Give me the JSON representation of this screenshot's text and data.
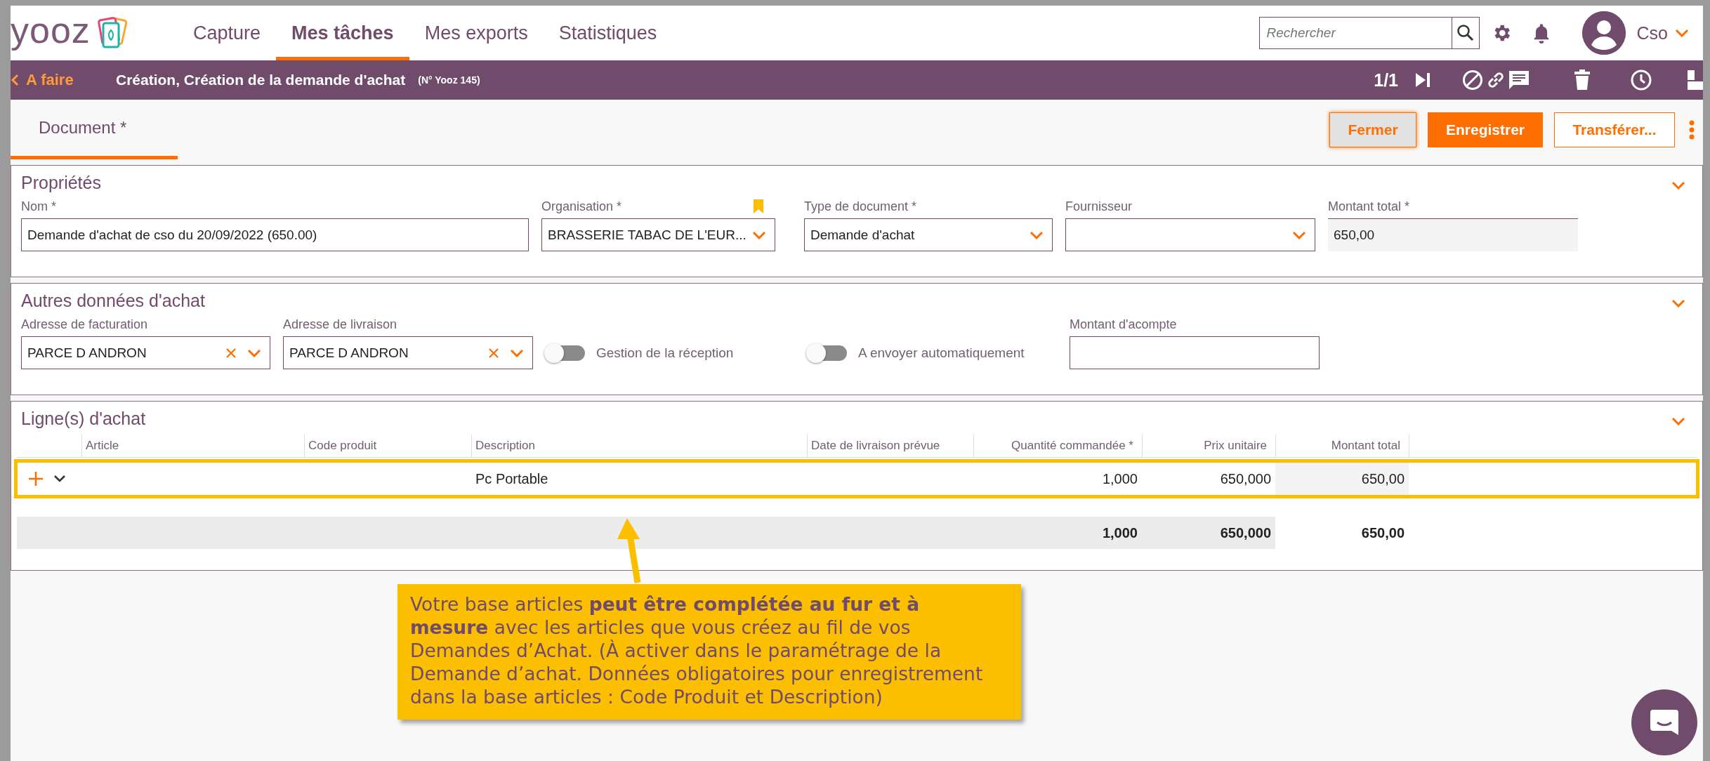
{
  "header": {
    "logo": "yooz",
    "nav": [
      {
        "label": "Capture",
        "selected": false
      },
      {
        "label": "Mes tâches",
        "selected": true
      },
      {
        "label": "Mes exports",
        "selected": false
      },
      {
        "label": "Statistiques",
        "selected": false
      }
    ],
    "search": {
      "placeholder": "Rechercher"
    },
    "user": "Cso"
  },
  "task_bar": {
    "back": "A faire",
    "title": "Création, Création de la demande d'achat",
    "reference": "(N° Yooz 145)",
    "pager": "1/1"
  },
  "tabs": [
    {
      "label": "Document *",
      "selected": true
    }
  ],
  "buttons": [
    {
      "label": "Fermer",
      "kind": "secondary"
    },
    {
      "label": "Enregistrer",
      "kind": "primary"
    },
    {
      "label": "Transférer...",
      "kind": "outline"
    }
  ],
  "properties": {
    "title": "Propriétés",
    "expanded": true,
    "fields": [
      {
        "kind": "text",
        "label": "Nom *",
        "value": "Demande d'achat de cso du 20/09/2022 (650.00)"
      },
      {
        "kind": "select",
        "label": "Organisation *",
        "value": "BRASSERIE TABAC DE L'EUR...",
        "bookmarked": true
      },
      {
        "kind": "select",
        "label": "Type de document *",
        "value": "Demande d'achat"
      },
      {
        "kind": "select",
        "label": "Fournisseur"
      },
      {
        "kind": "readonly",
        "label": "Montant total *",
        "value": "650,00"
      }
    ]
  },
  "purchase_data": {
    "title": "Autres données d'achat",
    "expanded": true,
    "fields": [
      {
        "kind": "select",
        "label": "Adresse de facturation",
        "value": "PARCE D ANDRON",
        "clearable": true
      },
      {
        "kind": "select",
        "label": "Adresse de livraison",
        "value": "PARCE D ANDRON",
        "clearable": true
      },
      {
        "kind": "toggle",
        "label": "Gestion de la réception",
        "on": false
      },
      {
        "kind": "toggle",
        "label": "A envoyer automatiquement",
        "on": false
      },
      {
        "kind": "text",
        "label": "Montant d'acompte"
      }
    ]
  },
  "purchase_lines": {
    "title": "Ligne(s) d'achat",
    "expanded": true,
    "columns": [
      {
        "label": "Article",
        "kind": "text"
      },
      {
        "label": "Code produit",
        "kind": "text"
      },
      {
        "label": "Description",
        "kind": "text"
      },
      {
        "label": "Date de livraison prévue",
        "kind": "text"
      },
      {
        "label": "Quantité commandée *",
        "kind": "number"
      },
      {
        "label": "Prix unitaire",
        "kind": "number"
      },
      {
        "label": "Montant total",
        "kind": "computed"
      }
    ],
    "rows": [
      {
        "cells": [
          null,
          null,
          "Pc Portable",
          null,
          "1,000",
          "650,000",
          "650,00"
        ],
        "highlighted": true
      }
    ],
    "totals": [
      "1,000",
      "650,000",
      "650,00"
    ]
  },
  "callout": {
    "text": "Votre base articles **peut être complétée au fur et à mesure** avec les articles que vous créez au fil de vos Demandes d’Achat. (À activer dans le paramétrage de la Demande d’achat. Données obligatoires pour enregistrement dans la base articles : Code Produit et Description)"
  }
}
